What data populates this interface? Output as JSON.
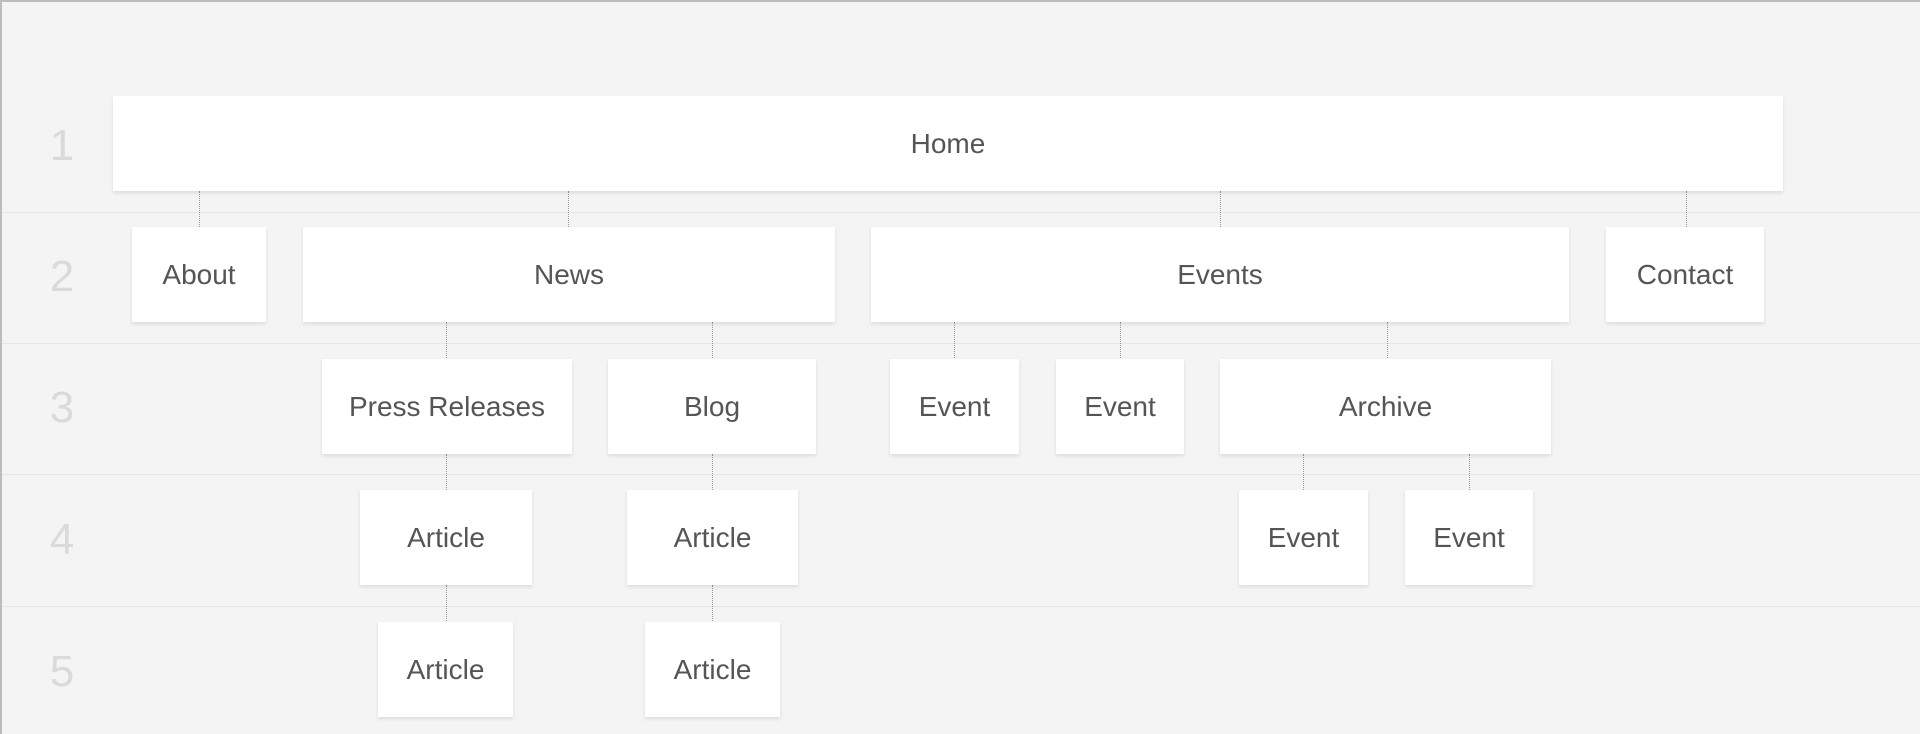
{
  "levels": [
    "1",
    "2",
    "3",
    "4",
    "5"
  ],
  "nodes": {
    "home": "Home",
    "about": "About",
    "news": "News",
    "events": "Events",
    "contact": "Contact",
    "press_releases": "Press Releases",
    "blog": "Blog",
    "event_a": "Event",
    "event_b": "Event",
    "archive": "Archive",
    "article_press_1": "Article",
    "article_blog_1": "Article",
    "archive_event_a": "Event",
    "archive_event_b": "Event",
    "article_press_2": "Article",
    "article_blog_2": "Article"
  },
  "colors": {
    "background": "#f4f4f4",
    "node": "#ffffff",
    "text": "#555555",
    "level_number": "#dadada",
    "connector": "#9a9a9a"
  }
}
